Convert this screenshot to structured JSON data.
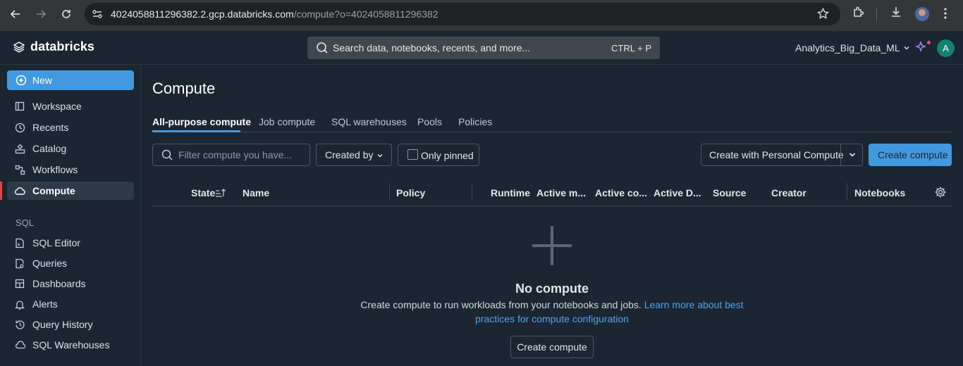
{
  "browser": {
    "url_host": "4024058811296382.2.gcp.databricks.com",
    "url_path": "/compute?o=4024058811296382"
  },
  "header": {
    "logo_text": "databricks",
    "search_placeholder": "Search data, notebooks, recents, and more...",
    "search_shortcut": "CTRL + P",
    "workspace_name": "Analytics_Big_Data_ML",
    "avatar_initial": "A"
  },
  "sidebar": {
    "new_label": "New",
    "items": [
      {
        "label": "Workspace",
        "icon": "workspace-icon"
      },
      {
        "label": "Recents",
        "icon": "clock-icon"
      },
      {
        "label": "Catalog",
        "icon": "catalog-icon"
      },
      {
        "label": "Workflows",
        "icon": "workflows-icon"
      },
      {
        "label": "Compute",
        "icon": "cloud-icon"
      }
    ],
    "sql_section": "SQL",
    "sql_items": [
      {
        "label": "SQL Editor",
        "icon": "sql-editor-icon"
      },
      {
        "label": "Queries",
        "icon": "queries-icon"
      },
      {
        "label": "Dashboards",
        "icon": "dashboards-icon"
      },
      {
        "label": "Alerts",
        "icon": "bell-icon"
      },
      {
        "label": "Query History",
        "icon": "history-icon"
      },
      {
        "label": "SQL Warehouses",
        "icon": "warehouse-icon"
      }
    ],
    "active_item": "Compute"
  },
  "main": {
    "title": "Compute",
    "tabs": [
      "All-purpose compute",
      "Job compute",
      "SQL warehouses",
      "Pools",
      "Policies"
    ],
    "active_tab": "All-purpose compute",
    "filter_placeholder": "Filter compute you have...",
    "created_by_label": "Created by",
    "only_pinned_label": "Only pinned",
    "personal_compute_label": "Create with Personal Compute",
    "create_compute_label": "Create compute",
    "columns": [
      "State",
      "Name",
      "Policy",
      "Runtime",
      "Active m...",
      "Active co...",
      "Active D...",
      "Source",
      "Creator",
      "Notebooks"
    ],
    "empty": {
      "title": "No compute",
      "description": "Create compute to run workloads from your notebooks and jobs.",
      "link_text": "Learn more about best practices for compute configuration",
      "button_label": "Create compute"
    }
  },
  "colors": {
    "accent": "#4299e0",
    "background": "#1b2631",
    "active_marker": "#e3453d"
  }
}
